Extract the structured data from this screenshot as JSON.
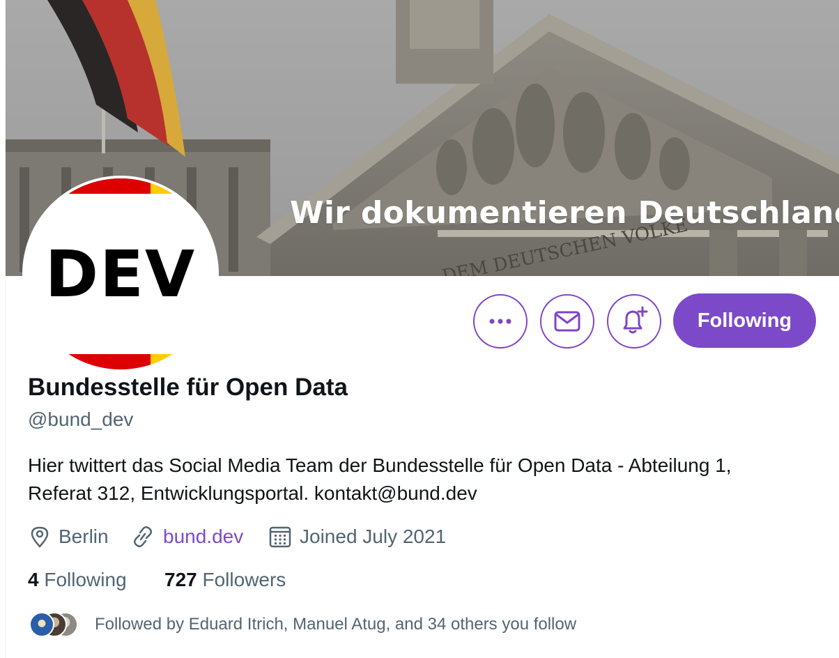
{
  "banner": {
    "caption": "Wir dokumentieren Deutschland",
    "inscription": "DEM DEUTSCHEN VOLKE"
  },
  "avatar": {
    "text": "DEV",
    "flag_colors": [
      "#000000",
      "#dd0000",
      "#ffcc00"
    ]
  },
  "actions": {
    "more_icon": "more-dots-icon",
    "message_icon": "envelope-icon",
    "notify_icon": "bell-plus-icon",
    "following_label": "Following"
  },
  "profile": {
    "name": "Bundesstelle für Open Data",
    "handle": "@bund_dev",
    "bio_line1": "Hier twittert das Social Media Team der Bundesstelle für Open Data - Abteilung 1,",
    "bio_line2": "Referat 312, Entwicklungsportal. kontakt@bund.dev",
    "location": "Berlin",
    "url": "bund.dev",
    "joined": "Joined July 2021"
  },
  "stats": {
    "following_count": "4",
    "following_label": "Following",
    "followers_count": "727",
    "followers_label": "Followers"
  },
  "followed_by": {
    "text": "Followed by Eduard Itrich, Manuel Atug, and 34 others you follow"
  },
  "colors": {
    "accent": "#7c4ac9",
    "secondary_text": "#536471",
    "primary_text": "#0f1419"
  }
}
